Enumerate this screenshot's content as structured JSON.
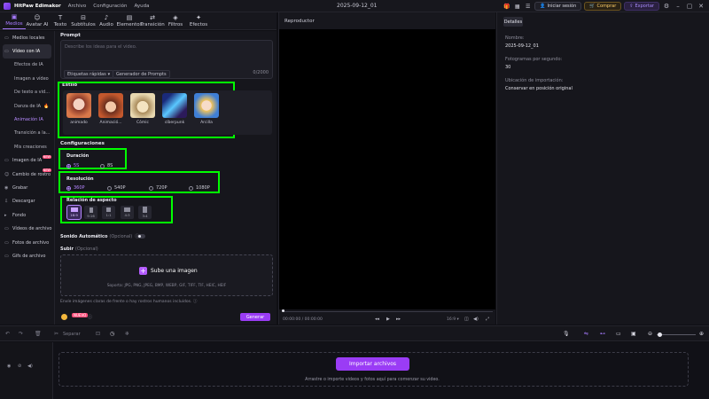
{
  "titlebar": {
    "app_name": "HitPaw Edimakor",
    "menus": [
      "Archivo",
      "Configuración",
      "Ayuda"
    ],
    "date": "2025-09-12_01",
    "login_label": "Iniciar sesión",
    "buy_label": "Comprar",
    "export_label": "Exportar"
  },
  "toolbar": {
    "tools": [
      {
        "label": "Medios",
        "icon": "media-icon"
      },
      {
        "label": "Avatar AI",
        "icon": "avatar-icon"
      },
      {
        "label": "Texto",
        "icon": "text-icon"
      },
      {
        "label": "Subtítulos",
        "icon": "subtitles-icon"
      },
      {
        "label": "Audio",
        "icon": "audio-icon"
      },
      {
        "label": "Elementos",
        "icon": "elements-icon"
      },
      {
        "label": "Transición",
        "icon": "transition-icon"
      },
      {
        "label": "Filtros",
        "icon": "filters-icon"
      },
      {
        "label": "Efectos",
        "icon": "effects-icon"
      }
    ]
  },
  "sidebar": {
    "items": [
      {
        "label": "Medios locales"
      },
      {
        "label": "Vídeo con IA"
      },
      {
        "label": "Efectos de IA"
      },
      {
        "label": "Imagen a vídeo"
      },
      {
        "label": "De texto a vid..."
      },
      {
        "label": "Danza de IA"
      },
      {
        "label": "Animación IA"
      },
      {
        "label": "Transición a la..."
      },
      {
        "label": "Mis creaciones"
      },
      {
        "label": "Imagen de IA",
        "badge": "NEW"
      },
      {
        "label": "Cambio de rostro",
        "badge": "NEW"
      },
      {
        "label": "Grabar"
      },
      {
        "label": "Descargar"
      },
      {
        "label": "Fondo"
      },
      {
        "label": "Vídeos de archivo"
      },
      {
        "label": "Fotos de archivo"
      },
      {
        "label": "Gifs de archivo"
      }
    ]
  },
  "prompt": {
    "title": "Prompt",
    "placeholder": "Describe los ideas para el video.",
    "tags_label": "Etiquetas rápidas",
    "generator_label": "Generador de Prompts",
    "counter": "0/2000"
  },
  "styles": {
    "title": "Estilo",
    "items": [
      {
        "label": "animado"
      },
      {
        "label": "Animació..."
      },
      {
        "label": "Cómic"
      },
      {
        "label": "cíberpunk"
      },
      {
        "label": "Arcilla"
      }
    ]
  },
  "settings": {
    "title": "Configuraciones",
    "duration_title": "Duración",
    "durations": [
      "5S",
      "8S"
    ],
    "resolution_title": "Resolución",
    "resolutions": [
      "360P",
      "540P",
      "720P",
      "1080P"
    ],
    "ratio_title": "Relación de aspecto",
    "ratios": [
      "16:9",
      "9:16",
      "1:1",
      "4:3",
      "3:4"
    ]
  },
  "sound": {
    "label": "Sonido Automático",
    "optional": "(Opcional)"
  },
  "upload": {
    "title": "Subir",
    "optional": "(Opcional)",
    "button_label": "Sube una imagen",
    "formats": "Soporta: JPG, PNG, JPEG, BMP, WEBP, GIF, TIFF, TIF, HEIC, HEIF",
    "note": "Envíe imágenes claras de frente o hay rostros humanos incluidos."
  },
  "footer": {
    "credit_tag": "NUEVO",
    "generate_label": "Generar"
  },
  "player": {
    "title": "Reproductor",
    "time_current": "00:00:00",
    "time_total": "00:00:00",
    "zoom": "16:9"
  },
  "details": {
    "tab_label": "Detalles",
    "name_label": "Nombre:",
    "name_value": "2025-09-12_01",
    "fps_label": "Fotogramas por segundo:",
    "fps_value": "30",
    "import_label": "Ubicación de importación:",
    "import_value": "Conservar en posición original"
  },
  "timeline": {
    "toolbar_label": "Separar",
    "import_button": "Importar archivos",
    "hint": "Arrastre o importe videos y fotos aquí para comenzar su video."
  },
  "colors": {
    "accent": "#9a3cf5",
    "highlight": "#00ff00",
    "background": "#16161c"
  }
}
